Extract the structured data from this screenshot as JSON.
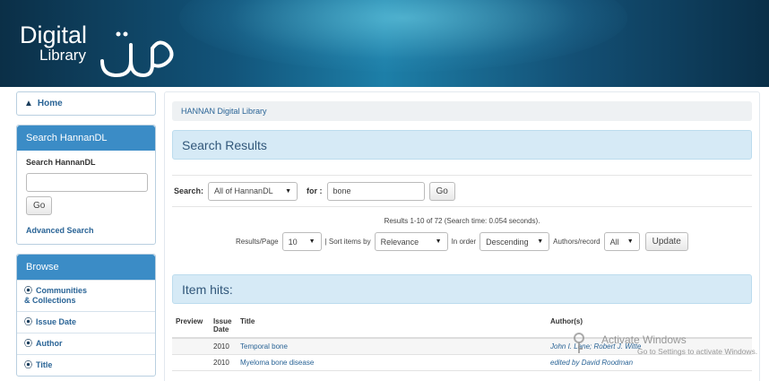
{
  "header": {
    "logo_line1": "Digital",
    "logo_line2": "Library"
  },
  "colors": {
    "header_dark": "#0b2f47",
    "accent_blue": "#3b8cc6",
    "link": "#2a6496",
    "panel_bg": "#d6eaf6"
  },
  "sidebar": {
    "home_label": "Home",
    "home_icon": "home-icon",
    "search_heading": "Search HannanDL",
    "search_label": "Search HannanDL",
    "search_value": "",
    "go_label": "Go",
    "advanced_label": "Advanced Search",
    "browse_heading": "Browse",
    "browse_icon": "circle-chevron-icon",
    "browse_items": [
      {
        "label_line1": "Communities",
        "label_line2": "& Collections"
      },
      {
        "label_line1": "Issue Date",
        "label_line2": ""
      },
      {
        "label_line1": "Author",
        "label_line2": ""
      },
      {
        "label_line1": "Title",
        "label_line2": ""
      }
    ]
  },
  "main": {
    "breadcrumb": "HANNAN Digital Library",
    "results_heading": "Search Results",
    "search_label": "Search:",
    "scope_value": "All of HannanDL",
    "for_label": "for :",
    "query_value": "bone",
    "go_label": "Go",
    "results_info": "Results 1-10 of 72 (Search time: 0.054 seconds).",
    "options": {
      "rpp_label": "Results/Page",
      "rpp_value": "10",
      "sort_label": "| Sort items by",
      "sort_value": "Relevance",
      "order_label": "In order",
      "order_value": "Descending",
      "authors_label": "Authors/record",
      "authors_value": "All",
      "update_label": "Update"
    },
    "item_hits_heading": "Item hits:",
    "table": {
      "headers": [
        "Preview",
        "Issue Date",
        "Title",
        "Author(s)"
      ],
      "header_issue_line1": "Issue",
      "header_issue_line2": "Date",
      "rows": [
        {
          "preview": "",
          "date": "2010",
          "title": "Temporal bone",
          "authors": "John I. Lane; Robert J. Witte"
        },
        {
          "preview": "",
          "date": "2010",
          "title": "Myeloma bone disease",
          "authors": "edited by David Roodman"
        }
      ]
    }
  },
  "overlay": {
    "activate_line1": "Activate Windows",
    "activate_line2": "Go to Settings to activate Windows."
  }
}
